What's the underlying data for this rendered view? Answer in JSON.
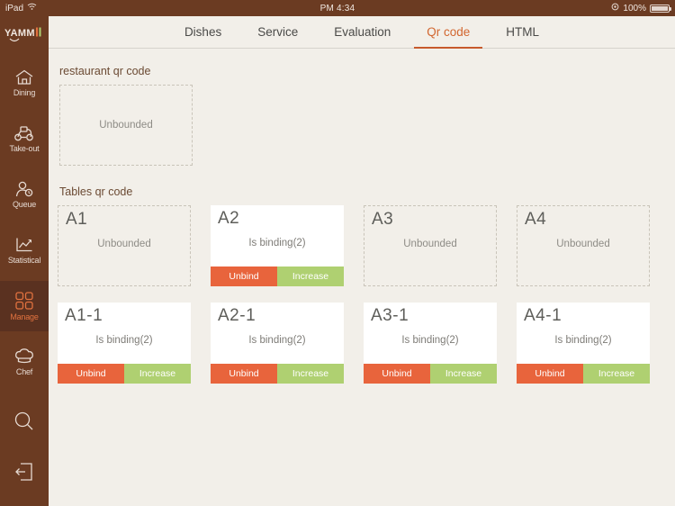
{
  "statusbar": {
    "device": "iPad",
    "wifi_icon": "wifi-icon",
    "time": "PM 4:34",
    "location_icon": "location-icon",
    "battery_percent": "100%"
  },
  "sidebar": {
    "logo_text": "YAMMI",
    "items": [
      {
        "label": "Dining",
        "icon": "house-icon",
        "active": false
      },
      {
        "label": "Take-out",
        "icon": "scooter-icon",
        "active": false
      },
      {
        "label": "Queue",
        "icon": "person-clock-icon",
        "active": false
      },
      {
        "label": "Statistical",
        "icon": "line-chart-icon",
        "active": false
      },
      {
        "label": "Manage",
        "icon": "grid-squares-icon",
        "active": true
      },
      {
        "label": "Chef",
        "icon": "chef-hat-icon",
        "active": false
      }
    ],
    "bottom_items": [
      {
        "icon": "search-icon"
      },
      {
        "icon": "logout-icon"
      }
    ]
  },
  "tabs": [
    {
      "label": "Dishes",
      "active": false
    },
    {
      "label": "Service",
      "active": false
    },
    {
      "label": "Evaluation",
      "active": false
    },
    {
      "label": "Qr code",
      "active": true
    },
    {
      "label": "HTML",
      "active": false
    }
  ],
  "sections": {
    "restaurant": {
      "title": "restaurant qr code",
      "status": "Unbounded"
    },
    "tables": {
      "title": "Tables qr code",
      "rows": [
        [
          {
            "label": "A1",
            "status": "Unbounded",
            "bound": false
          },
          {
            "label": "A2",
            "status": "Is binding(2)",
            "bound": true
          },
          {
            "label": "A3",
            "status": "Unbounded",
            "bound": false
          },
          {
            "label": "A4",
            "status": "Unbounded",
            "bound": false
          }
        ],
        [
          {
            "label": "A1-1",
            "status": "Is binding(2)",
            "bound": true
          },
          {
            "label": "A2-1",
            "status": "Is binding(2)",
            "bound": true
          },
          {
            "label": "A3-1",
            "status": "Is binding(2)",
            "bound": true
          },
          {
            "label": "A4-1",
            "status": "Is binding(2)",
            "bound": true
          }
        ]
      ]
    }
  },
  "buttons": {
    "unbind": "Unbind",
    "increase": "Increase"
  },
  "colors": {
    "sidebar_bg": "#6B3B22",
    "sidebar_active_bg": "#5A3120",
    "accent": "#D2662F",
    "unbind": "#E8643C",
    "increase": "#AFD071",
    "page_bg": "#F2EFE9"
  }
}
